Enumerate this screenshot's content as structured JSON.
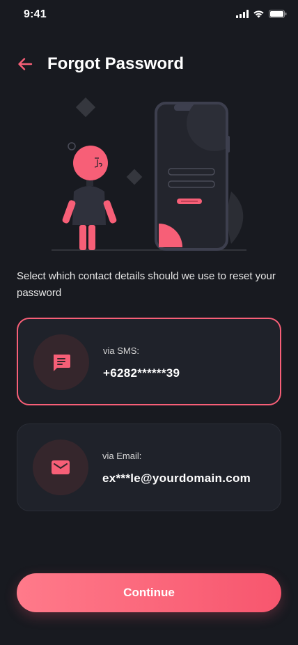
{
  "status_bar": {
    "time": "9:41",
    "icons": [
      "signal-icon",
      "wifi-icon",
      "battery-icon"
    ]
  },
  "header": {
    "back_icon": "arrow-left-icon",
    "title": "Forgot Password"
  },
  "description": "Select which contact details should we use to reset your password",
  "options": [
    {
      "icon": "message-icon",
      "label": "via SMS:",
      "value": "+6282******39",
      "selected": true
    },
    {
      "icon": "mail-icon",
      "label": "via Email:",
      "value": "ex***le@yourdomain.com",
      "selected": false
    }
  ],
  "continue_label": "Continue",
  "colors": {
    "background": "#181A20",
    "card": "#1F222A",
    "accent": "#F75F77",
    "icon_circle": "#35262C"
  }
}
